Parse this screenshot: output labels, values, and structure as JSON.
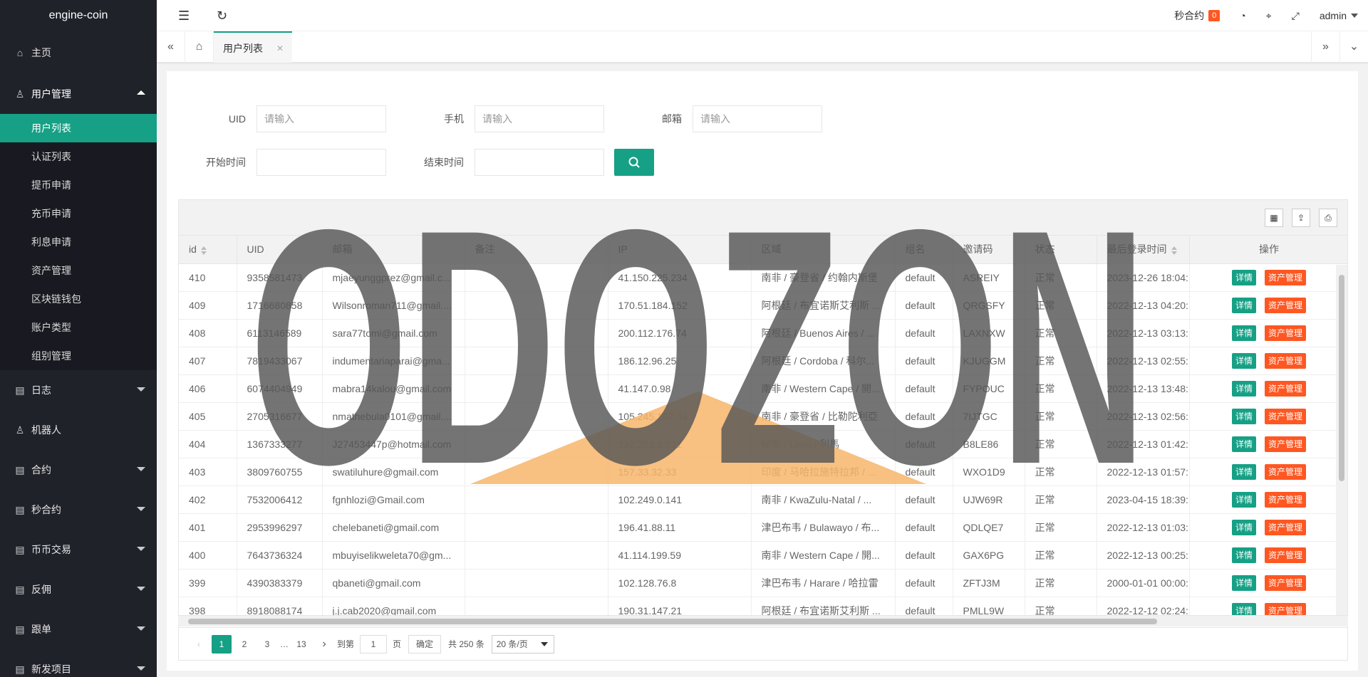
{
  "app_title": "engine-coin",
  "sidebar": {
    "items": [
      {
        "label": "主页",
        "icon": "home-icon"
      },
      {
        "label": "用户管理",
        "icon": "user-icon",
        "open": true
      },
      {
        "label": "日志",
        "icon": "doc-icon"
      },
      {
        "label": "机器人",
        "icon": "user-icon"
      },
      {
        "label": "合约",
        "icon": "doc-icon"
      },
      {
        "label": "秒合约",
        "icon": "doc-icon"
      },
      {
        "label": "币币交易",
        "icon": "doc-icon"
      },
      {
        "label": "反佣",
        "icon": "doc-icon"
      },
      {
        "label": "跟单",
        "icon": "doc-icon"
      },
      {
        "label": "新发项目",
        "icon": "doc-icon"
      }
    ],
    "submenu": [
      "用户列表",
      "认证列表",
      "提币申请",
      "充币申请",
      "利息申请",
      "资产管理",
      "区块链钱包",
      "账户类型",
      "组别管理"
    ]
  },
  "header": {
    "seconds_contract": "秒合约",
    "badge": "0",
    "user": "admin"
  },
  "tabs": {
    "active": "用户列表"
  },
  "filters": {
    "uid_label": "UID",
    "phone_label": "手机",
    "email_label": "邮箱",
    "start_label": "开始时间",
    "end_label": "结束时间",
    "placeholder": "请输入"
  },
  "table": {
    "columns": [
      "id",
      "UID",
      "邮箱",
      "备注",
      "IP",
      "区域",
      "组名",
      "邀请码",
      "状态",
      "最后登录时间",
      "操作"
    ],
    "detail_label": "详情",
    "asset_label": "资产管理",
    "rows": [
      [
        "410",
        "9358581473",
        "mjaeyunggprez@gmail.c...",
        "",
        "41.150.225.234",
        "南非 / 豪登省 / 约翰内斯堡",
        "default",
        "ASREIY",
        "正常",
        "2023-12-26 18:04:"
      ],
      [
        "409",
        "1716680858",
        "Wilsonroman711@gmail....",
        "",
        "170.51.184.152",
        "阿根廷 / 布宜诺斯艾利斯 ...",
        "default",
        "QRGSFY",
        "正常",
        "2022-12-13 04:20:"
      ],
      [
        "408",
        "6113146589",
        "sara77tomi@gmail.com",
        "",
        "200.112.176.74",
        "阿根廷 / Buenos Aires / ...",
        "default",
        "LAXNXW",
        "正常",
        "2022-12-13 03:13:"
      ],
      [
        "407",
        "7819433067",
        "indumentariaparai@gma...",
        "",
        "186.12.96.25",
        "阿根廷 / Cordoba / 科尔...",
        "default",
        "KJUGGM",
        "正常",
        "2022-12-13 02:55:"
      ],
      [
        "406",
        "6074404949",
        "mabra14kalou@gmail.com",
        "",
        "41.147.0.98",
        "南非 / Western Cape / 開...",
        "default",
        "FYPOUC",
        "正常",
        "2022-12-13 13:48:"
      ],
      [
        "405",
        "2705316677",
        "nmathebula0101@gmail....",
        "",
        "105.245.102.54",
        "南非 / 豪登省 / 比勒陀利亞",
        "default",
        "7IJTGC",
        "正常",
        "2022-12-13 02:56:"
      ],
      [
        "404",
        "1367333277",
        "J27453447p@hotmail.com",
        "",
        "132.251.1.231",
        "秘鲁 / Lima / 利馬",
        "default",
        "B8LE86",
        "正常",
        "2022-12-13 01:42:"
      ],
      [
        "403",
        "3809760755",
        "swatiluhure@gmail.com",
        "",
        "157.33.32.33",
        "印度 / 马哈拉施特拉邦 / ...",
        "default",
        "WXO1D9",
        "正常",
        "2022-12-13 01:57:"
      ],
      [
        "402",
        "7532006412",
        "fgnhlozi@Gmail.com",
        "",
        "102.249.0.141",
        "南非 / KwaZulu-Natal / ...",
        "default",
        "UJW69R",
        "正常",
        "2023-04-15 18:39:"
      ],
      [
        "401",
        "2953996297",
        "chelebaneti@gmail.com",
        "",
        "196.41.88.11",
        "津巴布韦 / Bulawayo / 布...",
        "default",
        "QDLQE7",
        "正常",
        "2022-12-13 01:03:"
      ],
      [
        "400",
        "7643736324",
        "mbuyiselikweleta70@gm...",
        "",
        "41.114.199.59",
        "南非 / Western Cape / 開...",
        "default",
        "GAX6PG",
        "正常",
        "2022-12-13 00:25:"
      ],
      [
        "399",
        "4390383379",
        "qbaneti@gmail.com",
        "",
        "102.128.76.8",
        "津巴布韦 / Harare / 哈拉雷",
        "default",
        "ZFTJ3M",
        "正常",
        "2000-01-01 00:00:"
      ],
      [
        "398",
        "8918088174",
        "j.j.cab2020@gmail.com",
        "",
        "190.31.147.21",
        "阿根廷 / 布宜诺斯艾利斯 ...",
        "default",
        "PMLL9W",
        "正常",
        "2022-12-12 02:24:"
      ]
    ]
  },
  "pager": {
    "pages": [
      "1",
      "2",
      "3",
      "…",
      "13"
    ],
    "goto_label": "到第",
    "goto_value": "1",
    "page_label": "页",
    "ok_label": "确定",
    "total": "共 250 条",
    "per_page": "20 条/页"
  },
  "watermark_text": "ODOZON"
}
